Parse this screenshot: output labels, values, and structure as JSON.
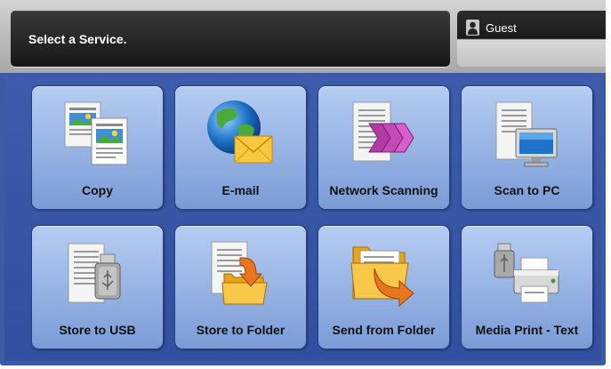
{
  "header": {
    "title": "Select a Service.",
    "user_icon": "user-icon",
    "user_name": "Guest"
  },
  "services": [
    {
      "label": "Copy",
      "icon": "copy-icon"
    },
    {
      "label": "E-mail",
      "icon": "email-icon"
    },
    {
      "label": "Network Scanning",
      "icon": "network-scanning-icon"
    },
    {
      "label": "Scan to PC",
      "icon": "scan-to-pc-icon"
    },
    {
      "label": "Store to USB",
      "icon": "store-to-usb-icon"
    },
    {
      "label": "Store to Folder",
      "icon": "store-to-folder-icon"
    },
    {
      "label": "Send from Folder",
      "icon": "send-from-folder-icon"
    },
    {
      "label": "Media Print - Text",
      "icon": "media-print-text-icon"
    }
  ],
  "colors": {
    "background": "#3c5aa6",
    "tile": "#97b4e4",
    "header_panel": "#1e1e1e",
    "folder": "#f5b52a",
    "arrow": "#e8761e",
    "envelope": "#f7c93e",
    "scan_arrows": "#b03aa6",
    "monitor_screen": "#1e73c8"
  }
}
